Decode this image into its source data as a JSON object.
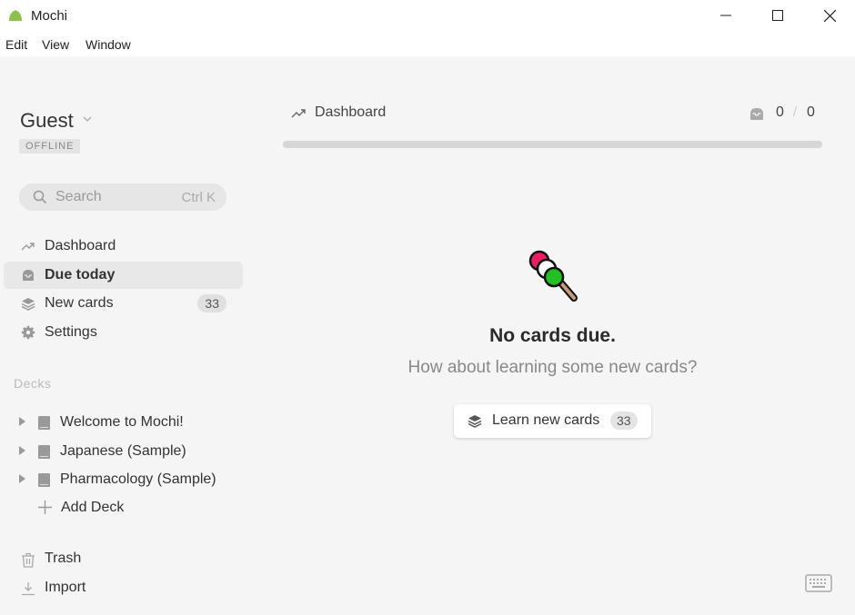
{
  "window": {
    "title": "Mochi",
    "controls": [
      "minimize",
      "maximize",
      "close"
    ]
  },
  "menu": {
    "items": [
      {
        "label": "Edit"
      },
      {
        "label": "View"
      },
      {
        "label": "Window"
      }
    ]
  },
  "sidebar": {
    "user": {
      "name": "Guest",
      "status": "OFFLINE"
    },
    "search": {
      "placeholder": "Search",
      "shortcut": "Ctrl K"
    },
    "nav": [
      {
        "label": "Dashboard",
        "icon": "trending-up-icon"
      },
      {
        "label": "Due today",
        "icon": "inbox-icon",
        "active": true
      },
      {
        "label": "New cards",
        "icon": "layers-icon",
        "count": "33"
      },
      {
        "label": "Settings",
        "icon": "gear-icon"
      }
    ],
    "decks_label": "Decks",
    "decks": [
      {
        "label": "Welcome to Mochi!"
      },
      {
        "label": "Japanese (Sample)"
      },
      {
        "label": "Pharmacology (Sample)"
      }
    ],
    "add_deck_label": "Add Deck",
    "footer": [
      {
        "label": "Trash",
        "icon": "trash-icon"
      },
      {
        "label": "Import",
        "icon": "download-icon"
      }
    ]
  },
  "main": {
    "breadcrumb": "Dashboard",
    "due": {
      "count": "0",
      "separator": "/",
      "total": "0"
    },
    "progress_fraction": 0,
    "empty_title": "No cards due.",
    "empty_subtitle": "How about learning some new cards?",
    "learn_button": {
      "label": "Learn new cards",
      "count": "33"
    }
  },
  "colors": {
    "background": "#f5f5f5",
    "titlebar": "#ffffff",
    "active_item": "#e8e8e8",
    "app_icon_green": "#8bc34a",
    "dango_pink": "#e91e63",
    "dango_white": "#ffffff",
    "dango_green": "#22c022"
  }
}
